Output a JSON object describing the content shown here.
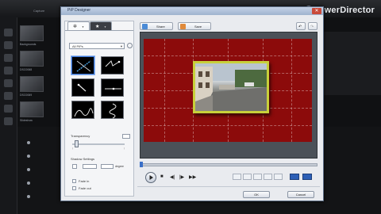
{
  "app": {
    "brand": "PowerDirector",
    "tabs": [
      "Capture",
      "Edit",
      "Produce",
      "Create Disc"
    ],
    "library_labels": [
      "Backgrounds",
      "DSC0068",
      "DSC0069",
      "Slideshow"
    ]
  },
  "dialog": {
    "title": "PiP Designer",
    "close_glyph": "✕",
    "filter_select": "All PiPs",
    "transparency_label": "Transparency",
    "transparency_value": 0.05,
    "shadow_label": "Shadow Settings",
    "shadow_unit": "degree",
    "fade_in": "Fade in",
    "fade_out": "Fade out",
    "share_label": "Share",
    "save_label": "Save",
    "ok_label": "OK",
    "cancel_label": "Cancel"
  },
  "colors": {
    "stage_red": "#8c0b0b",
    "pip_frame": "#c8d03a",
    "accent": "#2d5fb6"
  }
}
